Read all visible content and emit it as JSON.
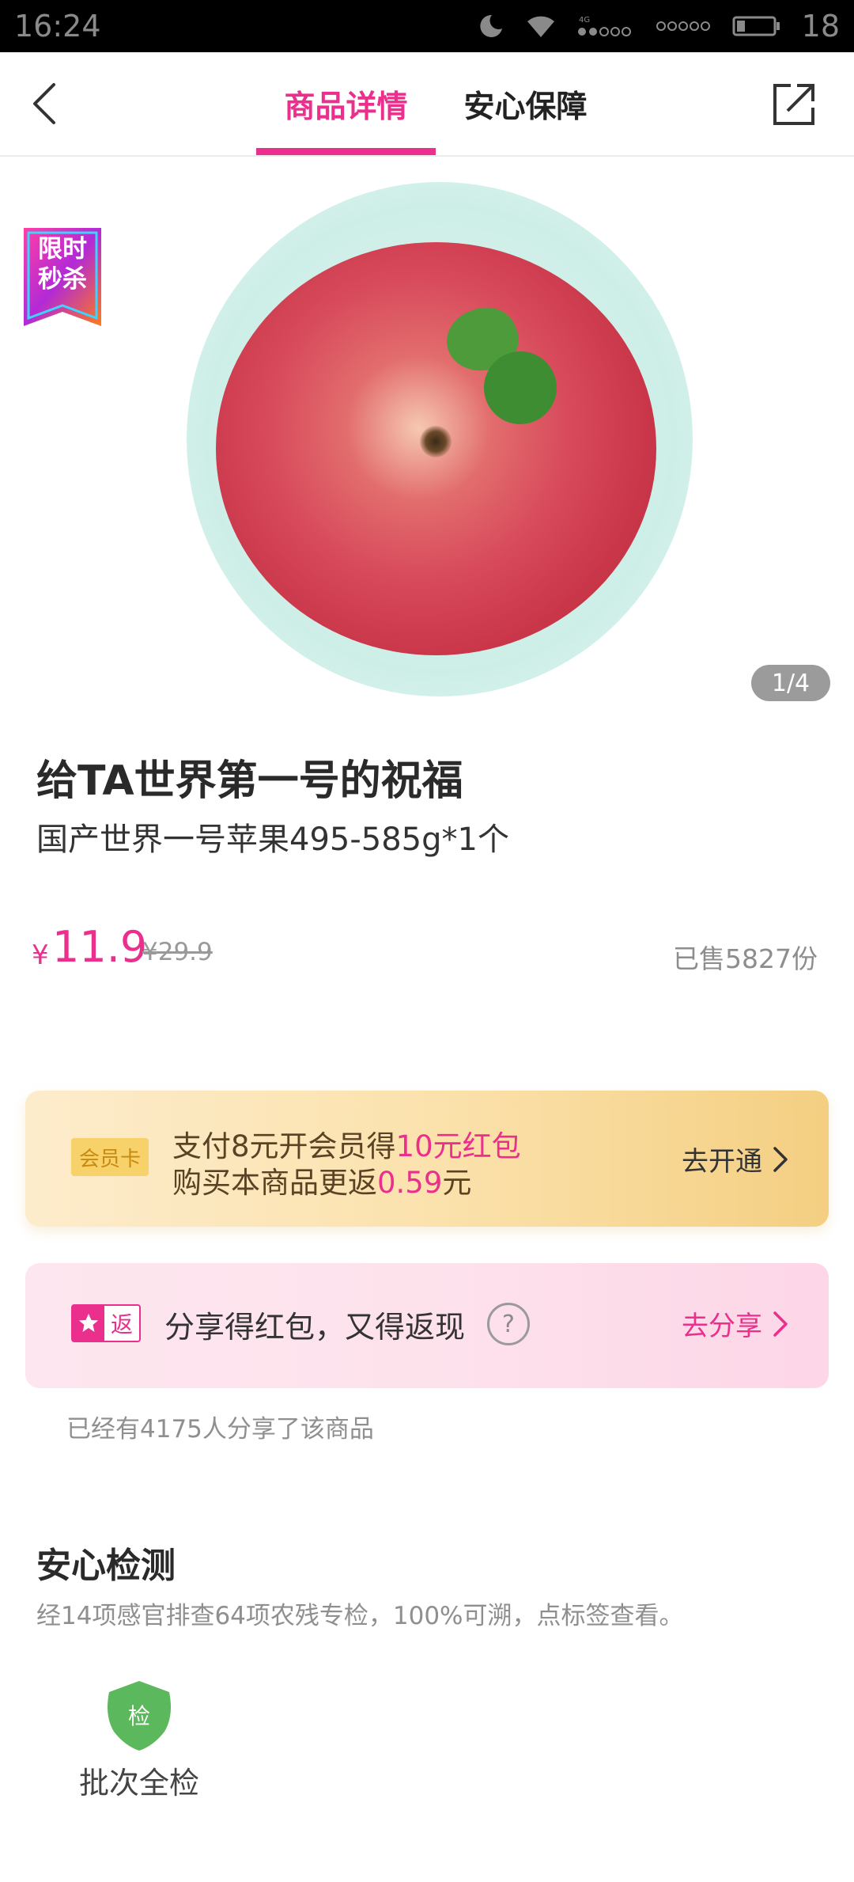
{
  "status_bar": {
    "time": "16:24",
    "battery": "18",
    "icons": [
      "wifi-icon",
      "signal-icon",
      "battery-icon"
    ]
  },
  "header": {
    "tabs": [
      {
        "label": "商品详情",
        "active": true
      },
      {
        "label": "安心保障",
        "active": false
      }
    ],
    "back_icon": "chevron-left-icon",
    "share_icon": "share-external-icon"
  },
  "hero": {
    "promo_badge_line1": "限时",
    "promo_badge_line2": "秒杀",
    "page_indicator": "1/4"
  },
  "product": {
    "title": "给TA世界第一号的祝福",
    "subtitle": "国产世界一号苹果495-585g*1个",
    "currency": "¥",
    "price": "11.9",
    "original_price": "¥29.9",
    "sold": "已售5827份"
  },
  "member_card": {
    "badge": "会员卡",
    "line1_prefix": "支付8元开会员得",
    "line1_highlight": "10元红包",
    "line2_prefix": "购买本商品更返",
    "line2_highlight": "0.59",
    "line2_suffix": "元",
    "cta": "去开通"
  },
  "share_card": {
    "badge_label": "返",
    "text": "分享得红包，又得返现",
    "help": "?",
    "cta": "去分享",
    "count_text": "已经有4175人分享了该商品"
  },
  "inspection": {
    "title": "安心检测",
    "subtitle": "经14项感官排查64项农残专检，100%可溯，点标签查看。",
    "item_icon_text": "检",
    "item_label": "批次全检"
  },
  "colors": {
    "accent": "#ea2f8d",
    "member_bg": "#fbe2ad",
    "share_bg": "#fde2ec",
    "inspect_green": "#5cb85c"
  }
}
